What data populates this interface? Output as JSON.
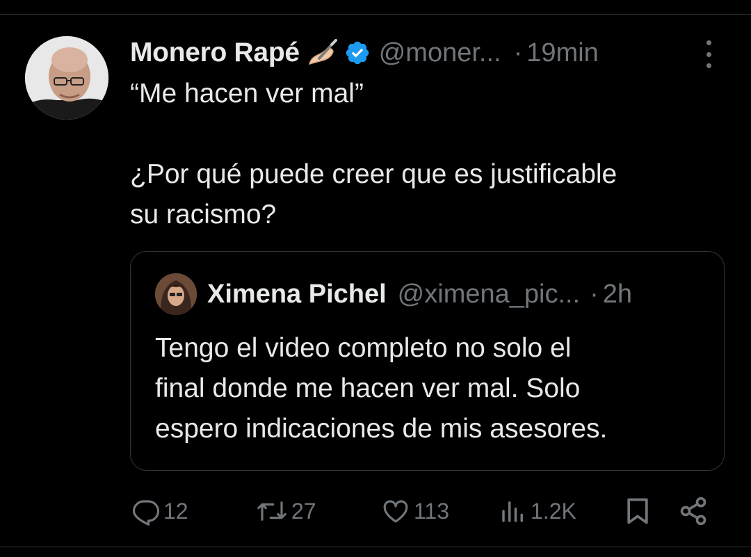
{
  "tweet": {
    "author_name": "Monero Rapé",
    "author_handle": "@moner...",
    "time": "19min",
    "dot": "·",
    "text_line1": "“Me hacen ver mal”",
    "text_line2": "¿Por qué puede creer que es justificable",
    "text_line3": "su racismo?"
  },
  "quote": {
    "author_name": "Ximena Pichel",
    "author_handle": "@ximena_pic...",
    "time": "2h",
    "dot": "·",
    "text_line1": "Tengo el video completo no solo el",
    "text_line2": "final donde me hacen ver mal. Solo",
    "text_line3": "espero indicaciones de mis asesores."
  },
  "actions": {
    "replies": "12",
    "retweets": "27",
    "likes": "113",
    "views": "1.2K"
  },
  "icons": {
    "author_emoji": "writing-hand-icon",
    "verified": "verified-badge-icon",
    "more": "more-vertical-icon",
    "reply": "reply-icon",
    "retweet": "retweet-icon",
    "like": "heart-icon",
    "views": "views-chart-icon",
    "bookmark": "bookmark-icon",
    "share": "share-icon"
  },
  "colors": {
    "background": "#000000",
    "text": "#e7e9ea",
    "secondary": "#71767b",
    "verified": "#1d9bf0",
    "border": "#2f3336"
  }
}
